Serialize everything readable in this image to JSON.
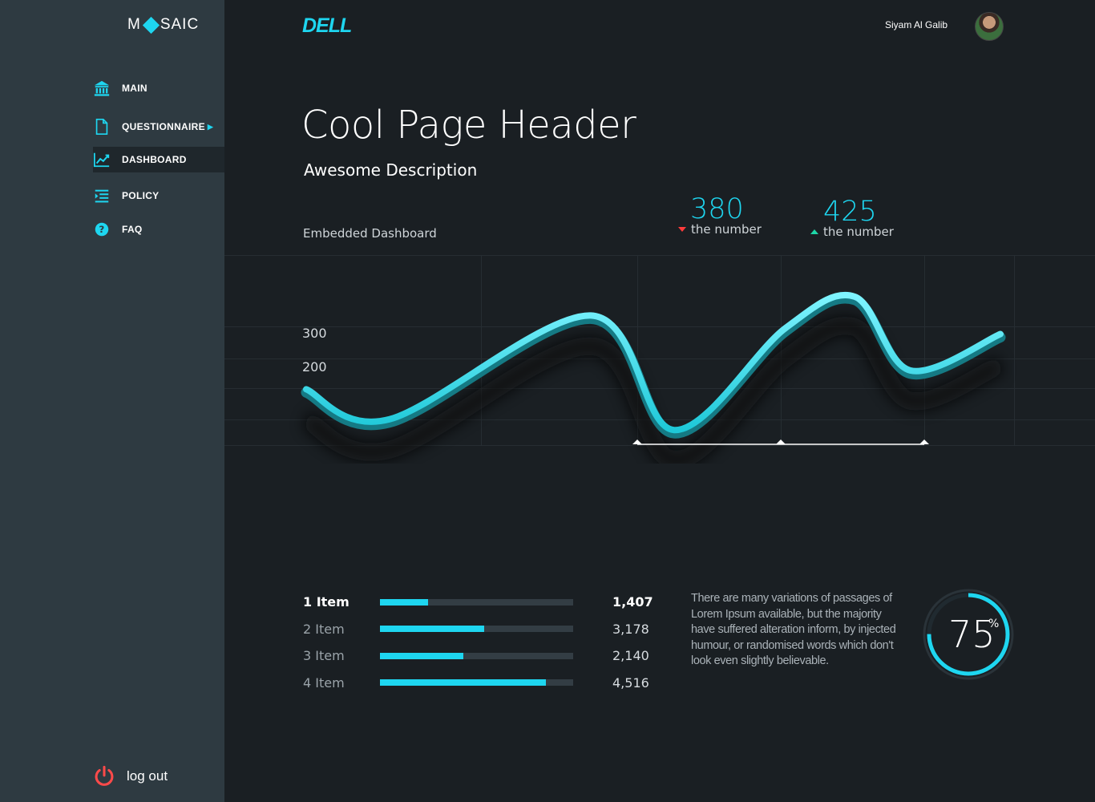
{
  "sidebar": {
    "logo": {
      "left": "M",
      "right": "SAIC"
    },
    "items": [
      {
        "label": "MAIN",
        "icon": "bank-icon"
      },
      {
        "label": "QUESTIONNAIRE",
        "icon": "document-icon",
        "has_caret": true
      },
      {
        "label": "DASHBOARD",
        "icon": "chart-line-icon",
        "active": true
      },
      {
        "label": "POLICY",
        "icon": "list-indent-icon"
      },
      {
        "label": "FAQ",
        "icon": "question-icon"
      }
    ],
    "logout_label": "log out"
  },
  "header": {
    "brand": "DELL",
    "user_name": "Siyam Al Galib"
  },
  "main": {
    "title": "Cool Page Header",
    "description": "Awesome Description",
    "embedded_label": "Embedded Dashboard",
    "stats": [
      {
        "value": "380",
        "label": "the number",
        "trend": "down"
      },
      {
        "value": "425",
        "label": "the number",
        "trend": "up"
      }
    ]
  },
  "chart_data": {
    "type": "line",
    "y_tick_labels": [
      "300",
      "200"
    ],
    "y_ticks": [
      300,
      200
    ],
    "line_color": "#1ed6f0",
    "grid": true,
    "points": [
      [
        0,
        161
      ],
      [
        0.12,
        72
      ],
      [
        0.41,
        380
      ],
      [
        0.53,
        40
      ],
      [
        0.69,
        342
      ],
      [
        0.79,
        436
      ],
      [
        0.87,
        217
      ],
      [
        1,
        325
      ]
    ]
  },
  "items": [
    {
      "name": "1 Item",
      "fraction": 0.25,
      "value": "1,407"
    },
    {
      "name": "2 Item",
      "fraction": 0.54,
      "value": "3,178"
    },
    {
      "name": "3 Item",
      "fraction": 0.43,
      "value": "2,140"
    },
    {
      "name": "4 Item",
      "fraction": 0.86,
      "value": "4,516"
    }
  ],
  "paragraph": "There are  many  variations of  passages of Lorem Ipsum available, but the majority have suffered alteration inform, by injected humour, or randomised words which don't look even slightly believable.",
  "gauge": {
    "value": "75",
    "unit": "%",
    "fraction": 0.75
  },
  "colors": {
    "accent": "#1ed6f0",
    "sidebar": "#2e3a41",
    "background": "#1a1f23",
    "down": "#ff3b3b",
    "up": "#1ed6a8",
    "logout": "#ff4a4a"
  }
}
